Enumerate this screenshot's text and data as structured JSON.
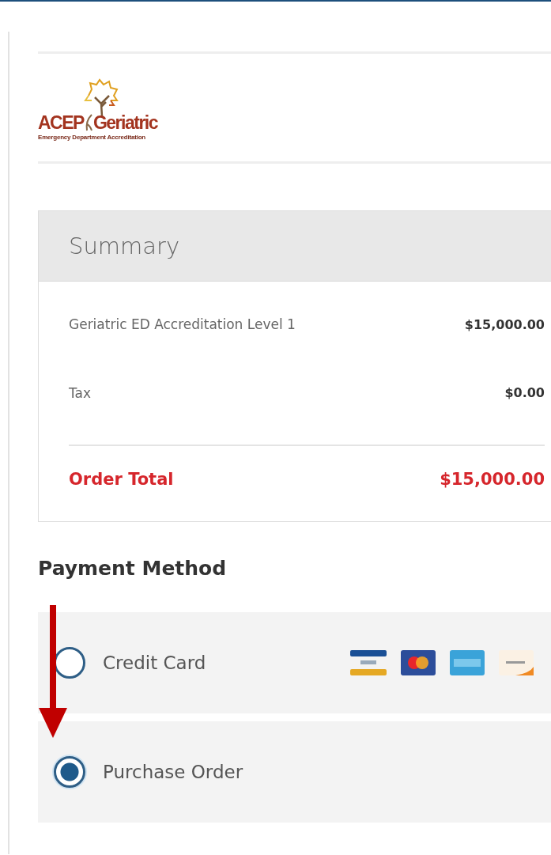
{
  "logo": {
    "name_left": "ACEP",
    "name_right": "Geriatric",
    "tagline": "Emergency Department Accreditation"
  },
  "summary": {
    "title": "Summary",
    "lines": [
      {
        "label": "Geriatric ED Accreditation Level 1",
        "amount": "$15,000.00"
      },
      {
        "label": "Tax",
        "amount": "$0.00"
      }
    ],
    "total": {
      "label": "Order Total",
      "amount": "$15,000.00"
    }
  },
  "payment": {
    "title": "Payment Method",
    "options": [
      {
        "kind": "card",
        "label": "Credit Card",
        "selected": false
      },
      {
        "kind": "plain",
        "label": "Purchase Order",
        "selected": true
      }
    ]
  }
}
